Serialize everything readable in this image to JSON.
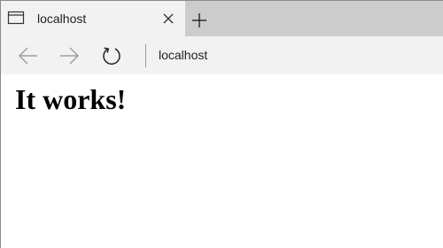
{
  "tab": {
    "title": "localhost",
    "favicon_icon": "page-icon",
    "close_icon": "close-icon"
  },
  "new_tab_icon": "plus-icon",
  "navigation": {
    "back_icon": "arrow-left-icon",
    "forward_icon": "arrow-right-icon",
    "refresh_icon": "refresh-icon"
  },
  "address_bar": {
    "url": "localhost"
  },
  "page": {
    "heading": "It works!"
  },
  "colors": {
    "tab_strip": "#cccccc",
    "active_tab": "#f2f2f2",
    "toolbar": "#f2f2f2",
    "content": "#ffffff"
  }
}
